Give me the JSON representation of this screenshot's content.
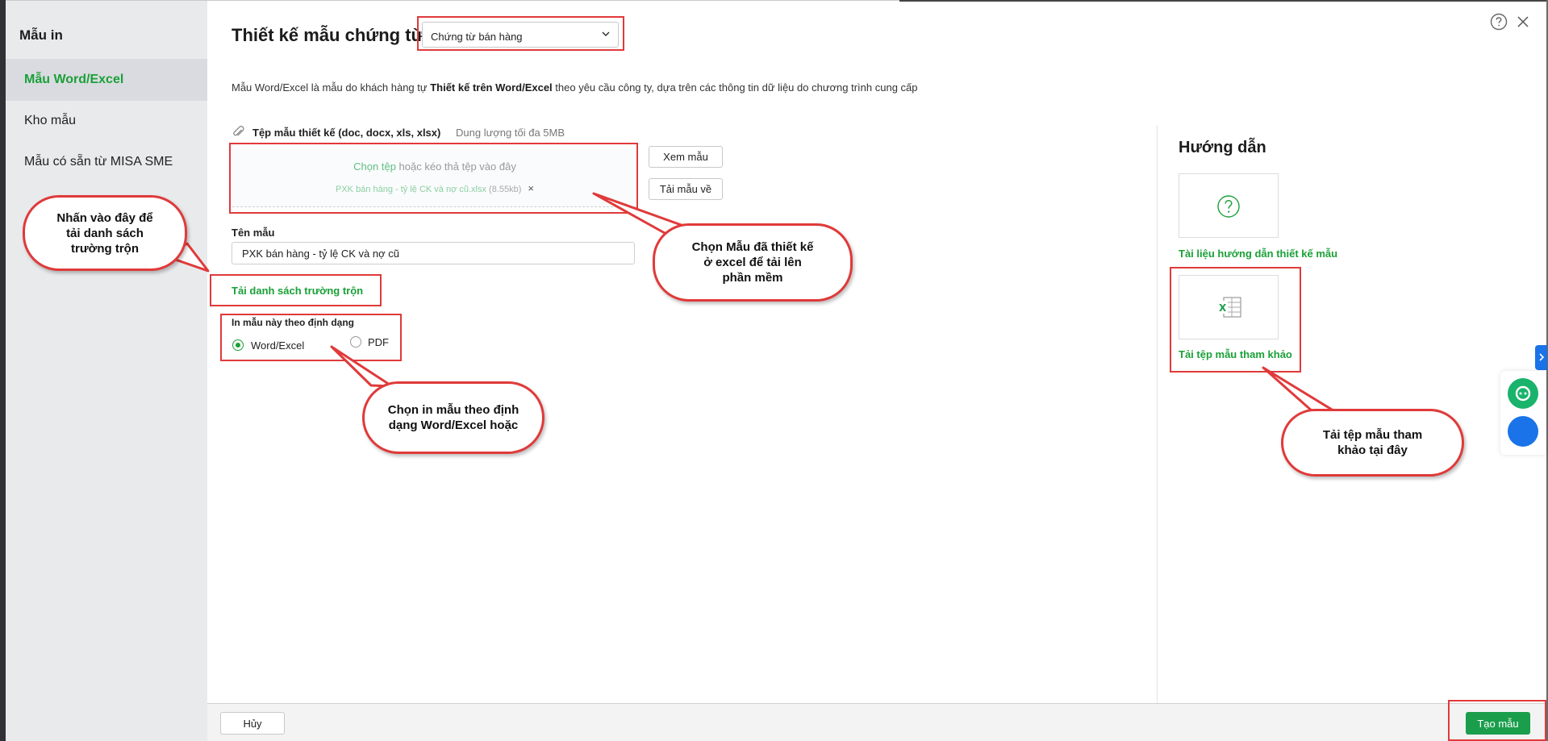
{
  "sidebar": {
    "title": "Mẫu in",
    "items": [
      {
        "label": "Mẫu Word/Excel",
        "active": true
      },
      {
        "label": "Kho mẫu",
        "active": false
      },
      {
        "label": "Mẫu có sẵn từ MISA SME",
        "active": false
      }
    ]
  },
  "header": {
    "title": "Thiết kế mẫu chứng từ",
    "doc_type_selected": "Chứng từ bán hàng"
  },
  "description": {
    "part1": "Mẫu Word/Excel là mẫu do khách hàng tự ",
    "bold": "Thiết kế trên Word/Excel",
    "part2": " theo yêu cầu công ty, dựa trên các thông tin dữ liệu do chương trình cung cấp"
  },
  "upload": {
    "label": "Tệp mẫu thiết kế (doc, docx, xls, xlsx)",
    "limit": "Dung lượng tối đa 5MB",
    "choose_link": "Chọn tệp",
    "drop_hint": " hoặc kéo thả tệp vào đây",
    "file_name": "PXK bán hàng - tỷ lệ CK và nợ cũ.xlsx",
    "file_size": "(8.55kb)",
    "remove": "×",
    "view_button": "Xem mẫu",
    "download_button": "Tải mẫu về"
  },
  "form": {
    "name_label": "Tên mẫu",
    "name_value": "PXK bán hàng - tỷ lệ CK và nợ cũ",
    "merge_link": "Tải danh sách trường trộn",
    "format_label": "In mẫu này theo định dạng",
    "format_options": [
      {
        "label": "Word/Excel",
        "selected": true
      },
      {
        "label": "PDF",
        "selected": false
      }
    ]
  },
  "guide": {
    "title": "Hướng dẫn",
    "doc_link": "Tài liệu hướng dẫn thiết kế mẫu",
    "sample_link": "Tải tệp mẫu tham khảo"
  },
  "footer": {
    "cancel": "Hủy",
    "create": "Tạo mẫu"
  },
  "annotations": {
    "merge_callout": "Nhấn vào đây để\ntải danh sách\ntrường trộn",
    "upload_callout": "Chọn Mẫu đã thiết kế\nở excel để tải lên\nphần mềm",
    "format_callout": "Chọn in mẫu theo định\ndạng Word/Excel hoặc",
    "sample_callout": "Tải tệp mẫu tham\nkhảo tại đây"
  },
  "colors": {
    "accent": "#1aa037",
    "annotation": "#e03a3a",
    "primary_button": "#1a9e4c"
  }
}
